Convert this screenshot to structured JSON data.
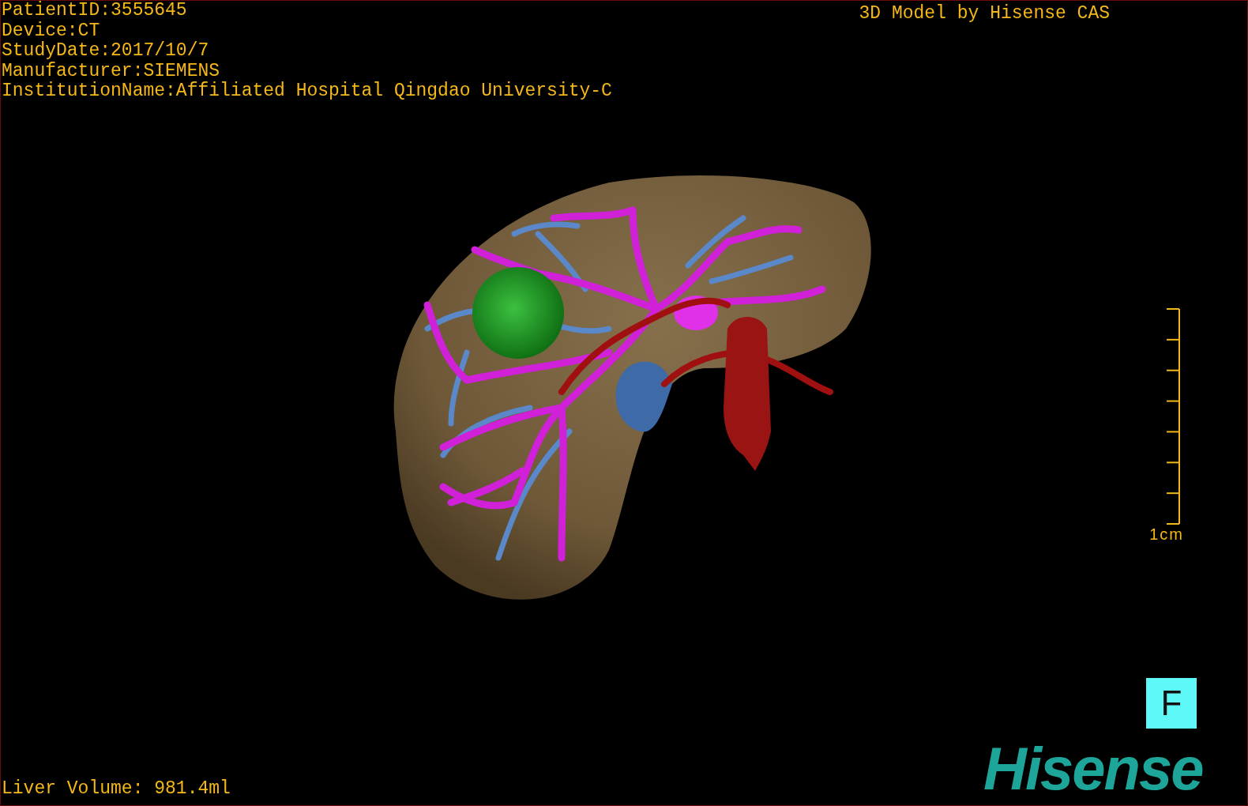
{
  "info_lines": [
    "PatientID:3555645",
    "Device:CT",
    "StudyDate:2017/10/7",
    "Manufacturer:SIEMENS",
    "InstitutionName:Affiliated Hospital Qingdao University-C"
  ],
  "title": "3D Model by Hisense CAS",
  "scale_bar": {
    "label": "1cm"
  },
  "orientation_marker": "F",
  "logo": "Hisense",
  "liver_volume": "Liver Volume: 981.4ml"
}
